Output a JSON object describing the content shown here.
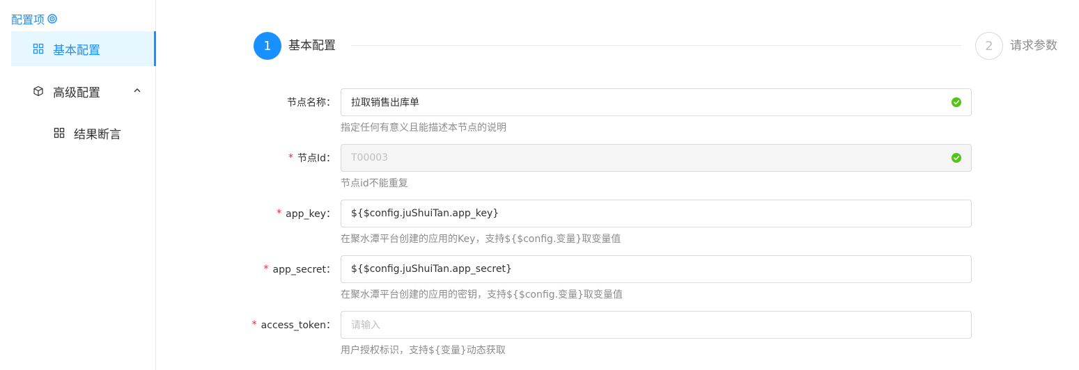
{
  "sidebar": {
    "title": "配置项",
    "items": [
      {
        "label": "基本配置",
        "icon": "grid-icon",
        "active": true
      },
      {
        "label": "高级配置",
        "icon": "cube-icon",
        "expanded": true
      },
      {
        "label": "结果断言",
        "icon": "grid-icon",
        "sub": true
      }
    ]
  },
  "steps": [
    {
      "number": "1",
      "title": "基本配置",
      "status": "active"
    },
    {
      "number": "2",
      "title": "请求参数",
      "status": "wait"
    }
  ],
  "form": {
    "fields": [
      {
        "label": "节点名称：",
        "required": false,
        "value": "拉取销售出库单",
        "placeholder": "",
        "help": "指定任何有意义且能描述本节点的说明",
        "valid": true,
        "disabled": false
      },
      {
        "label": "节点Id：",
        "required": true,
        "value": "T00003",
        "placeholder": "",
        "help": "节点id不能重复",
        "valid": true,
        "disabled": true
      },
      {
        "label": "app_key：",
        "required": true,
        "value": "${$config.juShuiTan.app_key}",
        "placeholder": "",
        "help": "在聚水潭平台创建的应用的Key，支持${$config.变量}取变量值",
        "valid": false,
        "disabled": false
      },
      {
        "label": "app_secret：",
        "required": true,
        "value": "${$config.juShuiTan.app_secret}",
        "placeholder": "",
        "help": "在聚水潭平台创建的应用的密钥，支持${$config.变量}取变量值",
        "valid": false,
        "disabled": false
      },
      {
        "label": "access_token：",
        "required": true,
        "value": "",
        "placeholder": "请输入",
        "help": "用户授权标识，支持${变量}动态获取",
        "valid": false,
        "disabled": false
      }
    ],
    "required_mark": "*"
  },
  "colors": {
    "accent": "#1890ff",
    "success": "#52c41a",
    "required": "#f5222d"
  }
}
